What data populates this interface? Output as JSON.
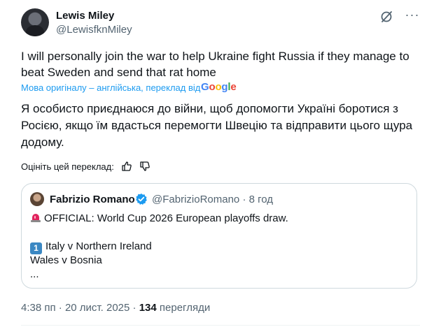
{
  "author": {
    "name": "Lewis Miley",
    "handle": "@LewisfknMiley"
  },
  "tweet": {
    "text": "I will personally join the war to help Ukraine fight Russia if they manage to beat Sweden and send that rat home",
    "translation_note": "Мова оригіналу – англійська, переклад від",
    "translation_provider": "Google",
    "translated_text": "Я особисто приєднаюся до війни, щоб допомогти Україні боротися з Росією, якщо їм вдасться перемогти Швецію та відправити цього щура додому.",
    "rate_translation_label": "Оцініть цей переклад:"
  },
  "quote": {
    "name": "Fabrizio Romano",
    "handle": "@FabrizioRomano",
    "separator": "·",
    "time": "8 год",
    "line1": "OFFICIAL: World Cup 2026 European playoffs draw.",
    "line2_number": "1",
    "line2": "Italy v Northern Ireland",
    "line3": "Wales v Bosnia",
    "line4": "..."
  },
  "meta": {
    "time": "4:38 пп",
    "separator1": "·",
    "date": "20 лист. 2025",
    "separator2": "·",
    "views_count": "134",
    "views_label": "перегляди"
  },
  "colors": {
    "link": "#1d9bf0",
    "secondary_text": "#536471",
    "border": "#cfd9de",
    "verified": "#1d9bf0"
  }
}
